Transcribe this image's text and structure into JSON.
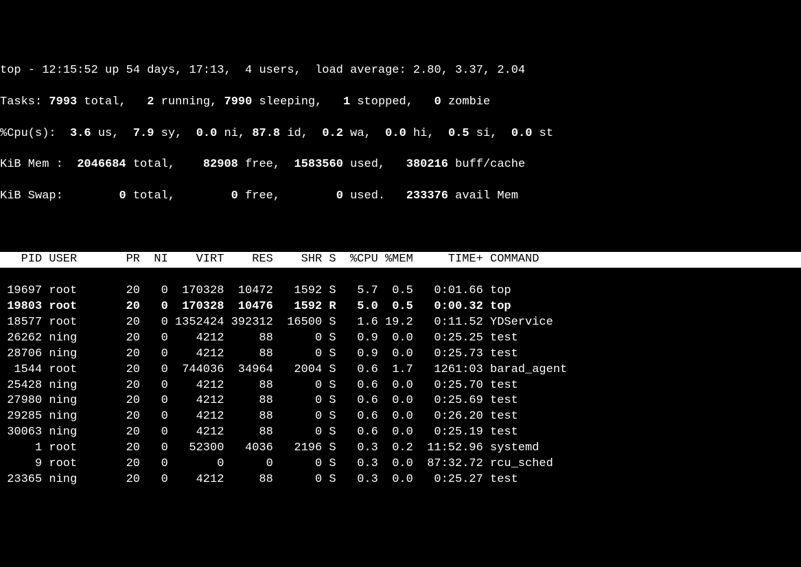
{
  "summary": {
    "line1_a": "top - 12:15:52 up 54 days, 17:13,  4 users,  load average: 2.80, 3.37, 2.04",
    "tasks_label": "Tasks: ",
    "tasks_total": "7993",
    "tasks_total_t": " total,   ",
    "tasks_running": "2",
    "tasks_running_t": " running, ",
    "tasks_sleeping": "7990",
    "tasks_sleeping_t": " sleeping,   ",
    "tasks_stopped": "1",
    "tasks_stopped_t": " stopped,   ",
    "tasks_zombie": "0",
    "tasks_zombie_t": " zombie",
    "cpu_label": "%Cpu(s):  ",
    "cpu_us": "3.6",
    "cpu_us_t": " us,  ",
    "cpu_sy": "7.9",
    "cpu_sy_t": " sy,  ",
    "cpu_ni": "0.0",
    "cpu_ni_t": " ni, ",
    "cpu_id": "87.8",
    "cpu_id_t": " id,  ",
    "cpu_wa": "0.2",
    "cpu_wa_t": " wa,  ",
    "cpu_hi": "0.0",
    "cpu_hi_t": " hi,  ",
    "cpu_si": "0.5",
    "cpu_si_t": " si,  ",
    "cpu_st": "0.0",
    "cpu_st_t": " st",
    "mem_label": "KiB Mem :  ",
    "mem_total": "2046684",
    "mem_total_t": " total,    ",
    "mem_free": "82908",
    "mem_free_t": " free,  ",
    "mem_used": "1583560",
    "mem_used_t": " used,   ",
    "mem_buff": "380216",
    "mem_buff_t": " buff/cache",
    "swap_label": "KiB Swap:        ",
    "swap_total": "0",
    "swap_total_t": " total,        ",
    "swap_free": "0",
    "swap_free_t": " free,        ",
    "swap_used": "0",
    "swap_used_t": " used.   ",
    "swap_avail": "233376",
    "swap_avail_t": " avail Mem"
  },
  "columns": {
    "pid": "PID",
    "user": "USER",
    "pr": "PR",
    "ni": "NI",
    "virt": "VIRT",
    "res": "RES",
    "shr": "SHR",
    "s": "S",
    "cpu": "%CPU",
    "mem": "%MEM",
    "time": "TIME+",
    "cmd": "COMMAND"
  },
  "rows": [
    {
      "pid": "19697",
      "user": "root",
      "pr": "20",
      "ni": "0",
      "virt": "170328",
      "res": "10472",
      "shr": "1592",
      "s": "S",
      "cpu": "5.7",
      "mem": "0.5",
      "time": "0:01.66",
      "cmd": "top",
      "bold": false
    },
    {
      "pid": "19803",
      "user": "root",
      "pr": "20",
      "ni": "0",
      "virt": "170328",
      "res": "10476",
      "shr": "1592",
      "s": "R",
      "cpu": "5.0",
      "mem": "0.5",
      "time": "0:00.32",
      "cmd": "top",
      "bold": true
    },
    {
      "pid": "18577",
      "user": "root",
      "pr": "20",
      "ni": "0",
      "virt": "1352424",
      "res": "392312",
      "shr": "16500",
      "s": "S",
      "cpu": "1.6",
      "mem": "19.2",
      "time": "0:11.52",
      "cmd": "YDService",
      "bold": false
    },
    {
      "pid": "26262",
      "user": "ning",
      "pr": "20",
      "ni": "0",
      "virt": "4212",
      "res": "88",
      "shr": "0",
      "s": "S",
      "cpu": "0.9",
      "mem": "0.0",
      "time": "0:25.25",
      "cmd": "test",
      "bold": false
    },
    {
      "pid": "28706",
      "user": "ning",
      "pr": "20",
      "ni": "0",
      "virt": "4212",
      "res": "88",
      "shr": "0",
      "s": "S",
      "cpu": "0.9",
      "mem": "0.0",
      "time": "0:25.73",
      "cmd": "test",
      "bold": false
    },
    {
      "pid": "1544",
      "user": "root",
      "pr": "20",
      "ni": "0",
      "virt": "744036",
      "res": "34964",
      "shr": "2004",
      "s": "S",
      "cpu": "0.6",
      "mem": "1.7",
      "time": "1261:03",
      "cmd": "barad_agent",
      "bold": false
    },
    {
      "pid": "25428",
      "user": "ning",
      "pr": "20",
      "ni": "0",
      "virt": "4212",
      "res": "88",
      "shr": "0",
      "s": "S",
      "cpu": "0.6",
      "mem": "0.0",
      "time": "0:25.70",
      "cmd": "test",
      "bold": false
    },
    {
      "pid": "27980",
      "user": "ning",
      "pr": "20",
      "ni": "0",
      "virt": "4212",
      "res": "88",
      "shr": "0",
      "s": "S",
      "cpu": "0.6",
      "mem": "0.0",
      "time": "0:25.69",
      "cmd": "test",
      "bold": false
    },
    {
      "pid": "29285",
      "user": "ning",
      "pr": "20",
      "ni": "0",
      "virt": "4212",
      "res": "88",
      "shr": "0",
      "s": "S",
      "cpu": "0.6",
      "mem": "0.0",
      "time": "0:26.20",
      "cmd": "test",
      "bold": false
    },
    {
      "pid": "30063",
      "user": "ning",
      "pr": "20",
      "ni": "0",
      "virt": "4212",
      "res": "88",
      "shr": "0",
      "s": "S",
      "cpu": "0.6",
      "mem": "0.0",
      "time": "0:25.19",
      "cmd": "test",
      "bold": false
    },
    {
      "pid": "1",
      "user": "root",
      "pr": "20",
      "ni": "0",
      "virt": "52300",
      "res": "4036",
      "shr": "2196",
      "s": "S",
      "cpu": "0.3",
      "mem": "0.2",
      "time": "11:52.96",
      "cmd": "systemd",
      "bold": false
    },
    {
      "pid": "9",
      "user": "root",
      "pr": "20",
      "ni": "0",
      "virt": "0",
      "res": "0",
      "shr": "0",
      "s": "S",
      "cpu": "0.3",
      "mem": "0.0",
      "time": "87:32.72",
      "cmd": "rcu_sched",
      "bold": false
    },
    {
      "pid": "23365",
      "user": "ning",
      "pr": "20",
      "ni": "0",
      "virt": "4212",
      "res": "88",
      "shr": "0",
      "s": "S",
      "cpu": "0.3",
      "mem": "0.0",
      "time": "0:25.27",
      "cmd": "test",
      "bold": false
    }
  ]
}
